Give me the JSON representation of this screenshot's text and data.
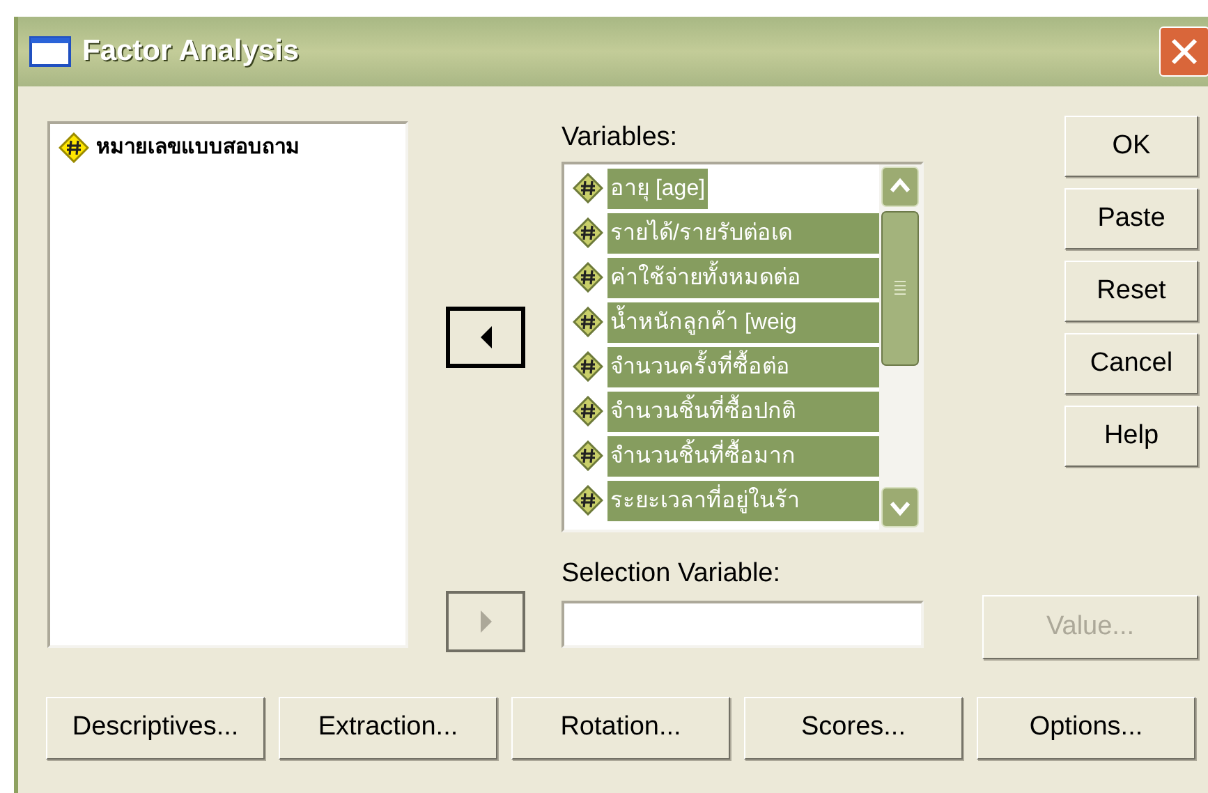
{
  "window": {
    "title": "Factor Analysis"
  },
  "source_list": {
    "items": [
      {
        "label": "หมายเลขแบบสอบถาม",
        "selected": false
      }
    ]
  },
  "move_buttons": [
    {
      "kind": "left",
      "disabled": false
    },
    {
      "kind": "right",
      "disabled": true
    }
  ],
  "variables": {
    "label": "Variables:",
    "items": [
      {
        "label": "อายุ [age]",
        "selected": true
      },
      {
        "label": "รายได้/รายรับต่อเด",
        "selected": true
      },
      {
        "label": "ค่าใช้จ่ายทั้งหมดต่อ",
        "selected": true
      },
      {
        "label": "น้ำหนักลูกค้า [weig",
        "selected": true
      },
      {
        "label": "จำนวนครั้งที่ซื้อต่อ",
        "selected": true
      },
      {
        "label": "จำนวนชิ้นที่ซื้อปกติ",
        "selected": true
      },
      {
        "label": "จำนวนชิ้นที่ซื้อมาก",
        "selected": true
      },
      {
        "label": "ระยะเวลาที่อยู่ในร้า",
        "selected": true
      }
    ]
  },
  "selection_variable": {
    "label": "Selection Variable:"
  },
  "side_buttons": [
    {
      "label": "OK",
      "disabled": false
    },
    {
      "label": "Paste",
      "disabled": false
    },
    {
      "label": "Reset",
      "disabled": false
    },
    {
      "label": "Cancel",
      "disabled": false
    },
    {
      "label": "Help",
      "disabled": false
    }
  ],
  "value_button": {
    "label": "Value...",
    "disabled": true
  },
  "bottom_buttons": [
    {
      "label": "Descriptives...",
      "disabled": false
    },
    {
      "label": "Extraction...",
      "disabled": false
    },
    {
      "label": "Rotation...",
      "disabled": false
    },
    {
      "label": "Scores...",
      "disabled": false
    },
    {
      "label": "Options...",
      "disabled": false
    }
  ]
}
